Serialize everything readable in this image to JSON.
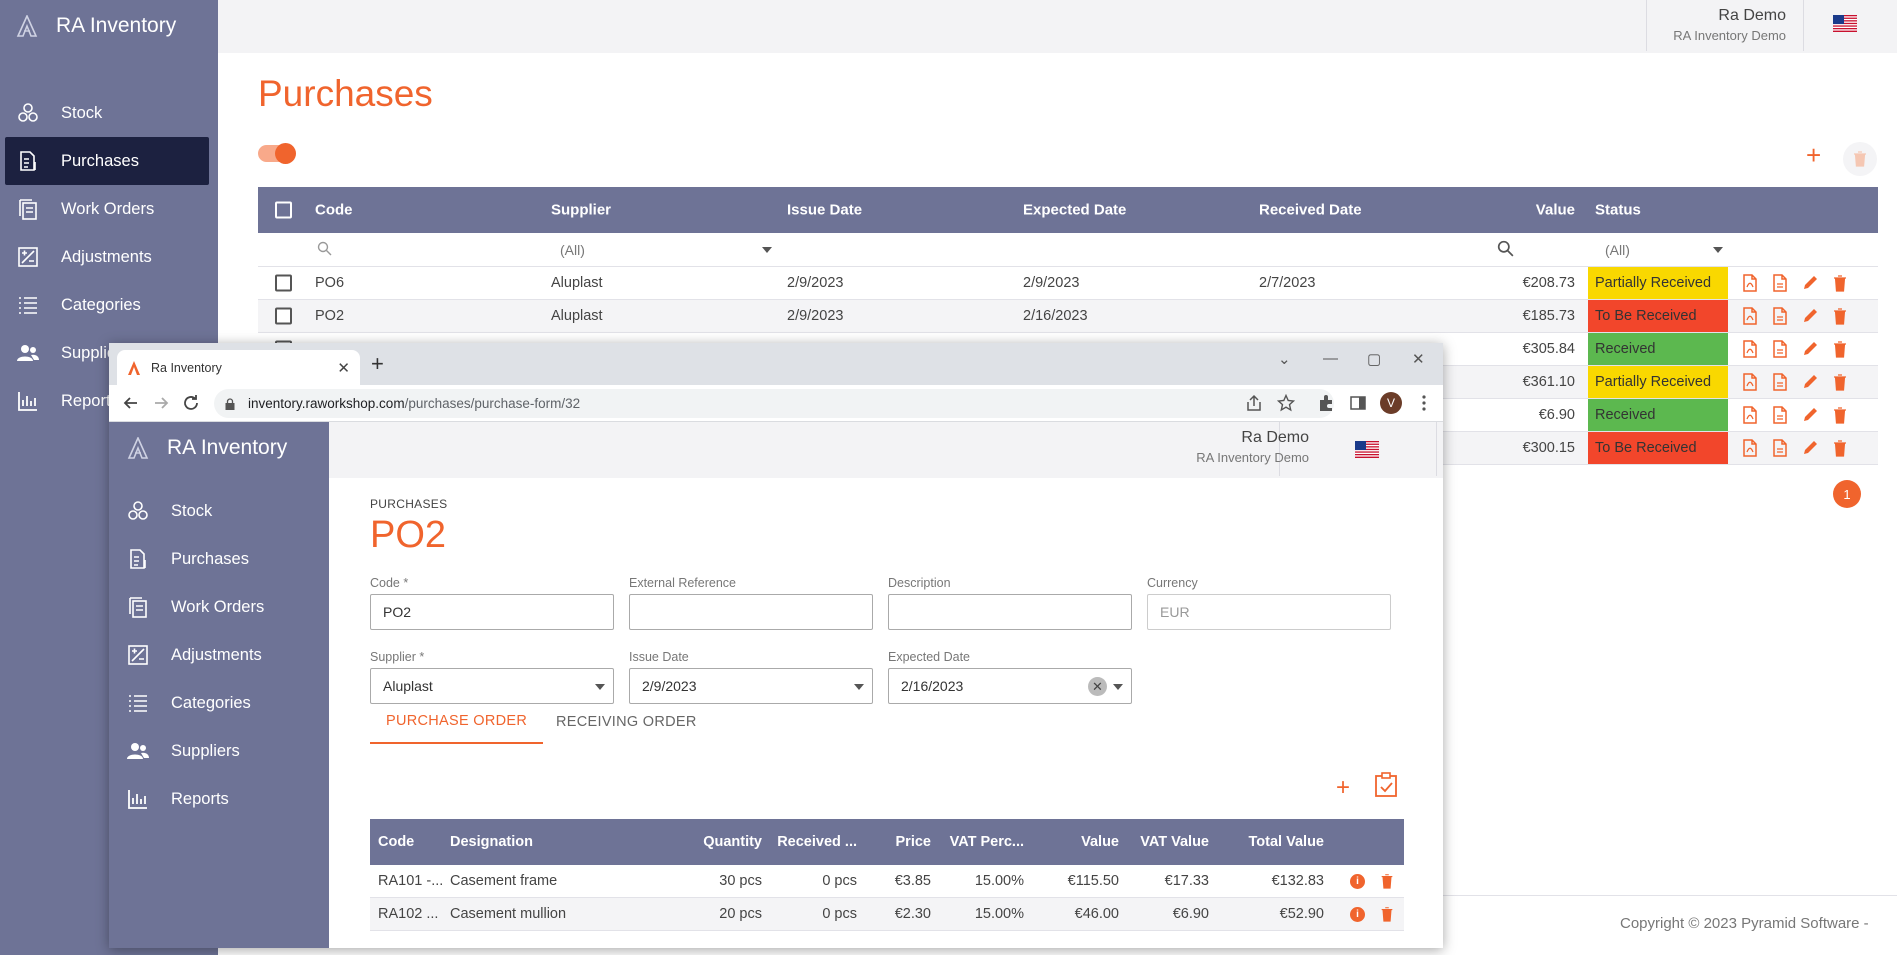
{
  "background": {
    "app_name": "RA Inventory",
    "nav": [
      {
        "label": "Stock",
        "icon": "stock-icon"
      },
      {
        "label": "Purchases",
        "icon": "purchases-icon",
        "active": true
      },
      {
        "label": "Work Orders",
        "icon": "work-orders-icon"
      },
      {
        "label": "Adjustments",
        "icon": "adjustments-icon"
      },
      {
        "label": "Categories",
        "icon": "categories-icon"
      },
      {
        "label": "Suppliers",
        "icon": "suppliers-icon"
      },
      {
        "label": "Reports",
        "icon": "reports-icon"
      }
    ],
    "user": {
      "name": "Ra Demo",
      "org": "RA Inventory Demo"
    },
    "page_title": "Purchases",
    "grid": {
      "columns": [
        "Code",
        "Supplier",
        "Issue Date",
        "Expected Date",
        "Received Date",
        "Value",
        "Status"
      ],
      "filters": {
        "supplier": "(All)",
        "status": "(All)"
      },
      "rows": [
        {
          "code": "PO6",
          "supplier": "Aluplast",
          "issue": "2/9/2023",
          "expected": "2/9/2023",
          "received": "2/7/2023",
          "value": "€208.73",
          "status": "Partially Received"
        },
        {
          "code": "PO2",
          "supplier": "Aluplast",
          "issue": "2/9/2023",
          "expected": "2/16/2023",
          "received": "",
          "value": "€185.73",
          "status": "To Be Received"
        },
        {
          "code": "",
          "supplier": "",
          "issue": "",
          "expected": "",
          "received": "",
          "value": "€305.84",
          "status": "Received"
        },
        {
          "code": "",
          "supplier": "",
          "issue": "",
          "expected": "",
          "received": "",
          "value": "€361.10",
          "status": "Partially Received"
        },
        {
          "code": "",
          "supplier": "",
          "issue": "",
          "expected": "",
          "received": "",
          "value": "€6.90",
          "status": "Received"
        },
        {
          "code": "",
          "supplier": "",
          "issue": "",
          "expected": "",
          "received": "",
          "value": "€300.15",
          "status": "To Be Received"
        }
      ]
    },
    "page_badge": "1",
    "copyright": "Copyright © 2023 Pyramid Software -"
  },
  "status_colors": {
    "Partially Received": "#f9d800",
    "To Be Received": "#f2462b",
    "Received": "#5cb84f"
  },
  "colors": {
    "accent": "#f0642d",
    "sidebar": "#6e7396",
    "sidebar_active": "#1c2140"
  },
  "browser": {
    "tab_title": "Ra Inventory",
    "url_host": "inventory.raworkshop.com",
    "url_path": "/purchases/purchase-form/32",
    "profile_initial": "V"
  },
  "popup": {
    "app_name": "RA Inventory",
    "user": {
      "name": "Ra Demo",
      "org": "RA Inventory Demo"
    },
    "breadcrumb": "PURCHASES",
    "title": "PO2",
    "fields": {
      "code": {
        "label": "Code *",
        "value": "PO2"
      },
      "external_reference": {
        "label": "External Reference",
        "value": ""
      },
      "description": {
        "label": "Description",
        "value": ""
      },
      "currency": {
        "label": "Currency",
        "value": "EUR"
      },
      "supplier": {
        "label": "Supplier *",
        "value": "Aluplast"
      },
      "issue_date": {
        "label": "Issue Date",
        "value": "2/9/2023"
      },
      "expected_date": {
        "label": "Expected Date",
        "value": "2/16/2023"
      }
    },
    "tabs": [
      "PURCHASE ORDER",
      "RECEIVING ORDER"
    ],
    "lines": {
      "columns": [
        "Code",
        "Designation",
        "Quantity",
        "Received ...",
        "Price",
        "VAT Perc...",
        "Value",
        "VAT Value",
        "Total Value"
      ],
      "rows": [
        {
          "code": "RA101 -...",
          "designation": "Casement frame",
          "quantity": "30 pcs",
          "received": "0 pcs",
          "price": "€3.85",
          "vat_perc": "15.00%",
          "value": "€115.50",
          "vat_value": "€17.33",
          "total": "€132.83"
        },
        {
          "code": "RA102 ...",
          "designation": "Casement mullion",
          "quantity": "20 pcs",
          "received": "0 pcs",
          "price": "€2.30",
          "vat_perc": "15.00%",
          "value": "€46.00",
          "vat_value": "€6.90",
          "total": "€52.90"
        }
      ]
    }
  }
}
